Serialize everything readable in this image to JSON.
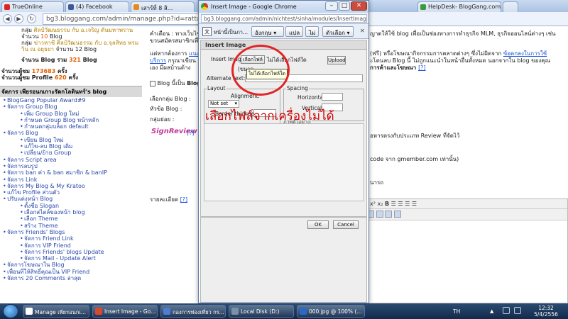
{
  "tabs": [
    {
      "label": "TrueOnline"
    },
    {
      "label": "(4) Facebook"
    },
    {
      "label": "เสาร์ที่ 8 สิ..."
    },
    {
      "label": "HelpDesk- BlogGang.com"
    }
  ],
  "main_url": "bg3.bloggang.com/admin/manage.php?id=rattan",
  "sidebar": {
    "stats_lines": [
      {
        "pre": "กลุ่ม ",
        "link": "ศิลป์วัฒนธรรม กับ อ.เจริญ ดันมหาพราน",
        "post": ""
      },
      {
        "pre": "จำนวน ",
        "link": "10",
        "post": " Blog"
      },
      {
        "pre": "กลุ่ม ",
        "link": "ข่าวหาชี ศิลป์วัฒนธรรม กับ อ.จุลสิทธ พรม",
        "post": ""
      },
      {
        "pre": "",
        "link": "วิน ณ อยุธยา",
        "post": " จำนวน 12 Blog"
      }
    ],
    "total_label": "จำนวน Blog รวม",
    "total_value": "321",
    "total_unit": "Blog",
    "visitors_label": "จำนวนผู้ชม",
    "visitors_value": "173683",
    "visitors_unit": "ครั้ง",
    "profile_label": "จำนวนผู้ชม Profile",
    "profile_value": "620",
    "profile_unit": "ครั้ง",
    "section_title": "จัดการ เพียรอนกเกาะรัดกโลตินทร์'s blog",
    "menu": [
      {
        "label": "BlogGang Popular Award#9",
        "level": 0
      },
      {
        "label": "จัดการ Group Blog",
        "level": 0
      },
      {
        "label": "เพิ่ม Group Blog ใหม่",
        "level": 1
      },
      {
        "label": "กำหนด Group Blog หน้าหลัก",
        "level": 1
      },
      {
        "label": "กำหนดกลุ่มบล็อก default",
        "level": 1
      },
      {
        "label": "จัดการ Blog",
        "level": 0
      },
      {
        "label": "เขียน Blog ใหม่",
        "level": 1
      },
      {
        "label": "แก้ไข-ลบ Blog เดิม",
        "level": 1
      },
      {
        "label": "เปลี่ยน/ย้าย Group",
        "level": 1
      },
      {
        "label": "จัดการ Script area",
        "level": 0
      },
      {
        "label": "จัดการลบรูป",
        "level": 0
      },
      {
        "label": "จัดการ ban ค่า & ban สมาชิก & banIP",
        "level": 0
      },
      {
        "label": "จัดการ Link",
        "level": 0
      },
      {
        "label": "จัดการ My Blog & My Kratoo",
        "level": 0
      },
      {
        "label": "แก้ไข Profile ส่วนตัว",
        "level": 0
      },
      {
        "label": "ปรับแต่งหน้า Blog",
        "level": 0
      },
      {
        "label": "ตั้งชื่อ Slogan",
        "level": 1
      },
      {
        "label": "เลือกสไตล์ของหน้า blog",
        "level": 1
      },
      {
        "label": "เลือก Theme",
        "level": 1
      },
      {
        "label": "สร้าง Theme",
        "level": 1
      },
      {
        "label": "จัดการ Friends' Blogs",
        "level": 0
      },
      {
        "label": "จัดการ Friend Link",
        "level": 1
      },
      {
        "label": "จัดการ VIP Friend",
        "level": 1
      },
      {
        "label": "จัดการ Friends' blogs Update",
        "level": 1
      },
      {
        "label": "จัดการ Mail - Update Alert",
        "level": 1
      },
      {
        "label": "จัดการโฆษณาใน Blog",
        "level": 0
      },
      {
        "label": "เพื่อนที่ให้สิทธิ์คุณเป็น VIP Friend",
        "level": 0
      },
      {
        "label": "จัดการ 20 Comments ล่าสุด",
        "level": 0
      }
    ]
  },
  "content": {
    "warning_label": "คำเตือน :",
    "warning_l1": "ทางเว็บไซต์",
    "warning_l1_right": "ญาตให้ใช้ blog เพื่อเป็นช่องทางการทำธุรกิจ MLM, ธุรกิจออนไลน์ต่างๆ เช่น",
    "warning_l2": "ขวนสมัครสมาชิกเพื่",
    "para_l1_left": "แต่หากต้องการ",
    "para_l1_link1": "แนะ",
    "para_l1_mid": "(ฟรี) หรือโฆษณากิจกรรมการตลาดต่างๆ ซึ่งไม่ผิดจาก",
    "para_l1_link2": "ข้อตกลงในการใช้",
    "para_l2_link": "บริการ",
    "para_l2_text": "กรุณาเขียน B",
    "para_l2_right": "ะโดนลบ Blog นี้ ไม่ถูกแนะนำในหน้าอื่นทั้งหมด นอกจากใน blog ของคุณ",
    "para_l3_left": "เอง มีผลบ้านด้าง",
    "para_l3_right": "การค้าและโฆษณา",
    "para_l3_end": "[?]",
    "checkbox_label": "Blog นี้เป็น",
    "checkbox_bold": "Blog",
    "group_label": "เลือกกลุ่ม Blog :",
    "title_label": "หัวข้อ Blog :",
    "cat_label": "กลุ่มย่อย :",
    "review_logo": "SignReview",
    "review_hint": "[?]",
    "review_right": "อหารตรงกับประเภท Review ที่จัดไว้",
    "code_right": "code จาก gmember.com เท่านั้น)",
    "nara": "นารถ",
    "detail_label": "รายละเอียด",
    "detail_hint": "[?]"
  },
  "popup": {
    "window_title": "Insert Image - Google Chrome",
    "url": "bg3.bloggang.com/admin/nichtest/sinha/modules/InsertImage/inser",
    "translate_prompt": "หน้านี้เป็นภา...",
    "lang_select": "อังกฤษ",
    "translate_btn": "แปล",
    "no_btn": "ไม่",
    "options_btn": "ตัวเลือก",
    "dialog_title": "Insert Image",
    "insert_image_label": "Insert Image:",
    "choose_file": "เลือกไฟล์",
    "no_file": "ไม่ได้เลือกไฟล์ใด",
    "size_label": "(ขนาด",
    "tooltip": "ไม่ได้เลือกไฟล์ใด",
    "upload": "Upload",
    "alt_label": "Alternate text:",
    "layout_legend": "Layout",
    "alignment_label": "Alignment:",
    "alignment_value": "Not set",
    "border_label": "Border thickness:",
    "spacing_legend": "Spacing",
    "horizontal_label": "Horizontal:",
    "vertical_label": "Vertical:",
    "preview_label": "ภาพตัวอย่าง:",
    "annotation": "เลือกไฟล์จากเครื่องไม่ได้",
    "ok": "OK",
    "cancel": "Cancel"
  },
  "taskbar": {
    "items": [
      {
        "label": "Manage เพียรอนกเ...",
        "color": "#ffffff"
      },
      {
        "label": "Insert Image - Go...",
        "color": "#d84a2f"
      },
      {
        "label": "กองการท่องเที่ยว กร...",
        "color": "#4a7fd4"
      },
      {
        "label": "Local Disk (D:)",
        "color": "#7a8fa8"
      },
      {
        "label": "000.jpg @ 100% (...",
        "color": "#2b69c9"
      }
    ],
    "lang": "TH",
    "time": "12:32",
    "date": "5/4/2556"
  },
  "colors": {
    "accent": "#1a55d8",
    "annotation": "#cc0000",
    "circle": "#e32424"
  }
}
